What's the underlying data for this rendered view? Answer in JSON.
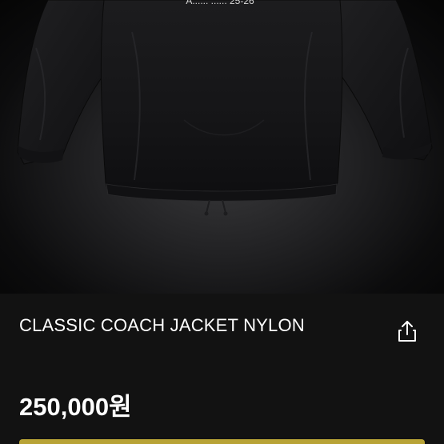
{
  "product": {
    "title": "CLASSIC COACH JACKET NYLON",
    "price": "250,000원",
    "image_print_text": "A...... ...... 25-26"
  },
  "icons": {
    "share": "share-icon"
  },
  "colors": {
    "background": "#121212",
    "text": "#ffffff",
    "accent": "#b8a336"
  }
}
